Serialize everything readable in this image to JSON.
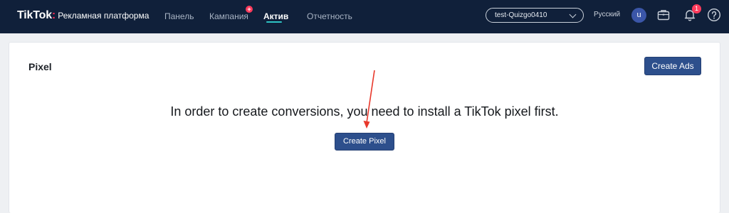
{
  "brand": {
    "logo_text": "TikTok",
    "logo_dot": ":",
    "subtitle": "Рекламная платформа"
  },
  "nav": {
    "items": [
      {
        "label": "Панель",
        "active": false
      },
      {
        "label": "Кампания",
        "active": false,
        "badge": "+"
      },
      {
        "label": "Актив",
        "active": true
      },
      {
        "label": "Отчетность",
        "active": false
      }
    ]
  },
  "header": {
    "account_name": "test-Quizgo0410",
    "language": "Русский",
    "avatar_initial": "u",
    "notification_count": "1",
    "help_icon": "question-circle-icon",
    "briefcase_icon": "briefcase-icon",
    "bell_icon": "bell-icon"
  },
  "page": {
    "title": "Pixel",
    "create_ads_label": "Create Ads",
    "message": "In order to create conversions, you need to install a TikTok pixel first.",
    "create_pixel_label": "Create Pixel"
  },
  "colors": {
    "topbar": "#10203a",
    "primary_button": "#2d4f8c",
    "active_underline": "#2ec4c4",
    "badge": "#ff3b5c",
    "annotation_arrow": "#e8382b"
  }
}
